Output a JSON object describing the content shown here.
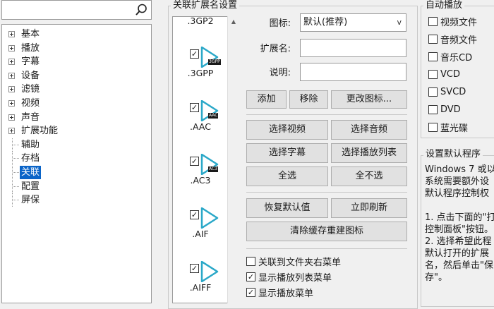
{
  "search": {
    "value": ""
  },
  "tree": {
    "items": [
      {
        "label": "基本",
        "expandable": true
      },
      {
        "label": "播放",
        "expandable": true
      },
      {
        "label": "字幕",
        "expandable": true
      },
      {
        "label": "设备",
        "expandable": true
      },
      {
        "label": "滤镜",
        "expandable": true
      },
      {
        "label": "视频",
        "expandable": true
      },
      {
        "label": "声音",
        "expandable": true
      },
      {
        "label": "扩展功能",
        "expandable": true
      },
      {
        "label": "辅助",
        "expandable": false
      },
      {
        "label": "存档",
        "expandable": false
      },
      {
        "label": "关联",
        "expandable": false,
        "selected": true
      },
      {
        "label": "配置",
        "expandable": false
      },
      {
        "label": "屏保",
        "expandable": false
      }
    ]
  },
  "ext_group": {
    "title": "关联扩展名设置",
    "list": [
      {
        "name": ".3GP2",
        "checked": true,
        "badge": ""
      },
      {
        "name": ".3GPP",
        "checked": true,
        "badge": "3GPP"
      },
      {
        "name": ".AAC",
        "checked": true,
        "badge": "AAC"
      },
      {
        "name": ".AC3",
        "checked": true,
        "badge": "AC3"
      },
      {
        "name": ".AIF",
        "checked": true,
        "badge": ""
      },
      {
        "name": ".AIFF",
        "checked": true,
        "badge": ""
      }
    ],
    "icon_label": "图标:",
    "icon_value": "默认(推荐)",
    "ext_label": "扩展名:",
    "ext_value": "",
    "desc_label": "说明:",
    "desc_value": "",
    "btn_add": "添加",
    "btn_remove": "移除",
    "btn_change_icon": "更改图标...",
    "btn_select_video": "选择视频",
    "btn_select_audio": "选择音频",
    "btn_select_subtitle": "选择字幕",
    "btn_select_playlist": "选择播放列表",
    "btn_select_all": "全选",
    "btn_select_none": "全不选",
    "btn_restore": "恢复默认值",
    "btn_refresh": "立即刷新",
    "btn_clear_cache": "清除缓存重建图标",
    "cb_folder_menu": {
      "label": "关联到文件夹右菜单",
      "checked": false
    },
    "cb_playlist_menu": {
      "label": "显示播放列表菜单",
      "checked": true
    },
    "cb_play_menu": {
      "label": "显示播放菜单",
      "checked": true
    }
  },
  "autoplay": {
    "title": "自动播放",
    "items": [
      {
        "label": "视频文件",
        "checked": false
      },
      {
        "label": "音频文件",
        "checked": false
      },
      {
        "label": "音乐CD",
        "checked": false
      },
      {
        "label": "VCD",
        "checked": false
      },
      {
        "label": "SVCD",
        "checked": false
      },
      {
        "label": "DVD",
        "checked": false
      },
      {
        "label": "蓝光碟",
        "checked": false
      }
    ]
  },
  "default_program": {
    "title": "设置默认程序",
    "lines": [
      "Windows 7 或以",
      "系统需要额外设",
      "默认程序控制权",
      "",
      "1. 点击下面的\"打",
      "控制面板\"按钮。",
      "2. 选择希望此程",
      "默认打开的扩展",
      "名，然后单击\"保",
      "存\"。"
    ]
  },
  "colors": {
    "selection": "#0a64c8",
    "icon_accent": "#2aa8c8"
  }
}
